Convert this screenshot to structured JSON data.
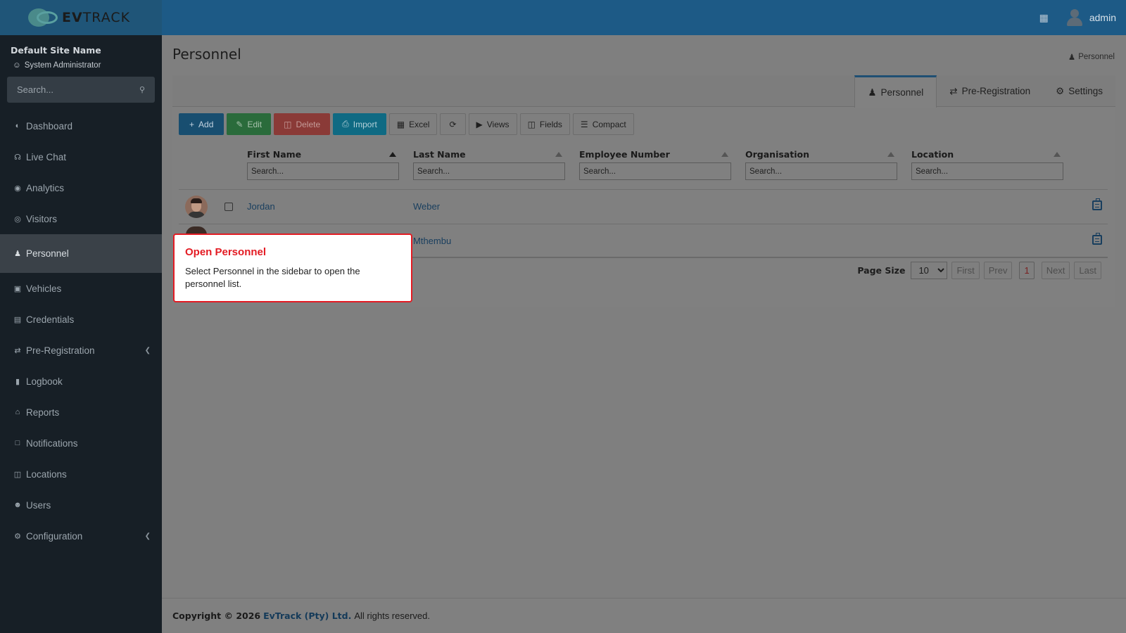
{
  "header": {
    "logo_text_bold": "EV",
    "logo_text_light": "TRACK",
    "user_name": "admin",
    "icon_building": "building-icon"
  },
  "sidebar": {
    "site_name": "Default Site Name",
    "role": "System Administrator",
    "search_placeholder": "Search...",
    "items": [
      {
        "label": "Dashboard",
        "icon": "dashboard-icon"
      },
      {
        "label": "Live Chat",
        "icon": "headset-icon"
      },
      {
        "label": "Analytics",
        "icon": "target-icon"
      },
      {
        "label": "Visitors",
        "icon": "eye-icon"
      },
      {
        "label": "Personnel",
        "icon": "user-tie-icon"
      },
      {
        "label": "Vehicles",
        "icon": "car-icon"
      },
      {
        "label": "Credentials",
        "icon": "id-badge-icon"
      },
      {
        "label": "Pre-Registration",
        "icon": "exchange-icon"
      },
      {
        "label": "Logbook",
        "icon": "book-icon"
      },
      {
        "label": "Reports",
        "icon": "chart-icon"
      },
      {
        "label": "Notifications",
        "icon": "message-icon"
      },
      {
        "label": "Locations",
        "icon": "map-icon"
      },
      {
        "label": "Users",
        "icon": "users-icon"
      },
      {
        "label": "Configuration",
        "icon": "gear-icon"
      }
    ]
  },
  "page": {
    "title": "Personnel",
    "breadcrumb": "Personnel"
  },
  "tabs": [
    {
      "label": "Personnel"
    },
    {
      "label": "Pre-Registration"
    },
    {
      "label": "Settings"
    }
  ],
  "toolbar": {
    "add": "Add",
    "edit": "Edit",
    "delete": "Delete",
    "import": "Import",
    "excel": "Excel",
    "views": "Views",
    "fields": "Fields",
    "compact": "Compact"
  },
  "grid": {
    "columns": [
      "First Name",
      "Last Name",
      "Employee Number",
      "Organisation",
      "Location"
    ],
    "filter_placeholder": "Search...",
    "rows": [
      {
        "first_name": "Jordan",
        "last_name": "Weber"
      },
      {
        "first_name": "",
        "last_name": "Mthembu"
      }
    ]
  },
  "pager": {
    "page_size_label": "Page Size",
    "page_size": "10",
    "first": "First",
    "prev": "Prev",
    "current": "1",
    "next": "Next",
    "last": "Last"
  },
  "footer": {
    "copyright": "Copyright © 2026",
    "company": "EvTrack (Pty) Ltd.",
    "rights": "All rights reserved."
  },
  "callout": {
    "title": "Open Personnel",
    "body": "Select Personnel in the sidebar to open the personnel list."
  },
  "colors": {
    "header": "#1d5a86",
    "sidebar": "#171f26",
    "callout_border": "#e31b23",
    "link": "#183e5e"
  }
}
